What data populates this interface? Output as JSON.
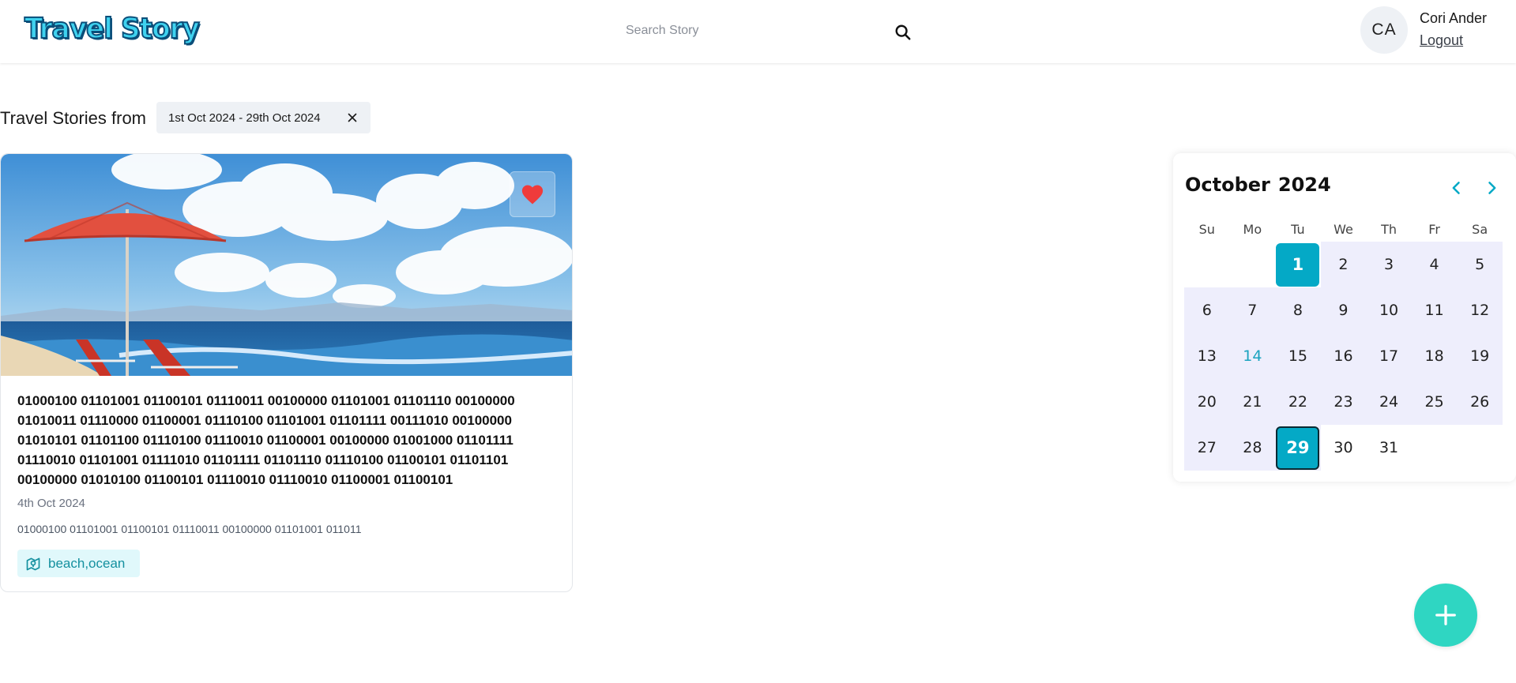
{
  "header": {
    "logo_text": "Travel Story",
    "search": {
      "placeholder": "Search Story",
      "value": ""
    },
    "user": {
      "initials": "CA",
      "name": "Cori Ander",
      "logout_label": "Logout"
    }
  },
  "filter": {
    "label": "Travel Stories from",
    "range_label": "1st Oct 2024 - 29th Oct 2024"
  },
  "stories": [
    {
      "title": "01000100 01101001 01100101 01110011 00100000 01101001 01101110 00100000 01010011 01110000 01100001 01110100 01101001 01101111 00111010 00100000 01010101 01101100 01110100 01110010 01100001 00100000 01001000 01101111 01110010 01101001 01111010 01101111 01101110 01110100 01100101 01101101 00100000 01010100 01100101 01110010 01110010 01100001 01100101",
      "date": "4th Oct 2024",
      "excerpt": "01000100 01101001 01100101 01110011 00100000 01101001 011011",
      "tags": "beach,ocean",
      "is_favourite": true,
      "image_alt": "beach umbrella and chairs by the ocean"
    }
  ],
  "calendar": {
    "month": "October",
    "year": "2024",
    "weekdays": [
      "Su",
      "Mo",
      "Tu",
      "We",
      "Th",
      "Fr",
      "Sa"
    ],
    "weeks": [
      [
        "",
        "",
        "1",
        "2",
        "3",
        "4",
        "5"
      ],
      [
        "6",
        "7",
        "8",
        "9",
        "10",
        "11",
        "12"
      ],
      [
        "13",
        "14",
        "15",
        "16",
        "17",
        "18",
        "19"
      ],
      [
        "20",
        "21",
        "22",
        "23",
        "24",
        "25",
        "26"
      ],
      [
        "27",
        "28",
        "29",
        "30",
        "31",
        "",
        ""
      ]
    ],
    "range_start": 1,
    "range_end": 29,
    "today": 14
  },
  "colors": {
    "accent": "#04a9c6",
    "range_bg": "#eeeefc",
    "fab": "#2fd6c2",
    "tag_bg": "#e0f8fb",
    "tag_text": "#14909f",
    "favourite": "#ef3b3b"
  },
  "icons": {
    "search": "search-icon",
    "close": "close-icon",
    "favourite": "heart-icon",
    "tag": "map-pin-icon",
    "prev": "chevron-left-icon",
    "next": "chevron-right-icon",
    "add": "plus-icon"
  }
}
